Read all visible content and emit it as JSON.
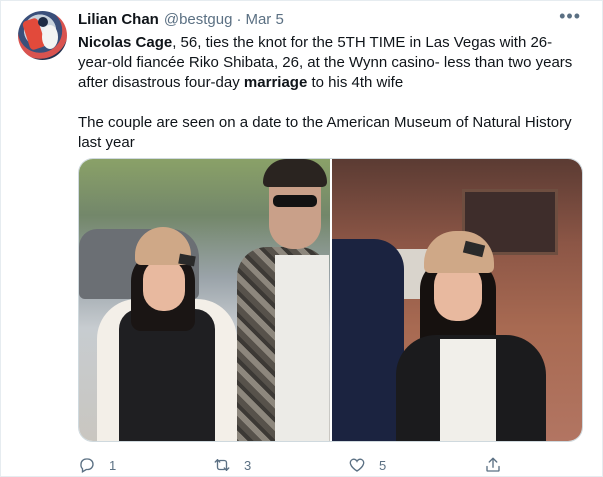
{
  "tweet": {
    "author_name": "Lilian Chan",
    "handle": "@bestgug",
    "separator": "·",
    "date": "Mar 5",
    "more_label": "•••",
    "text": {
      "bold_name": "Nicolas Cage",
      "part1": ", 56, ties the knot for the 5TH TIME in Las Vegas with 26-year-old fiancée Riko Shibata, 26, at the Wynn casino- less than two years after disastrous four-day ",
      "bold_word": "marriage",
      "part2": " to his 4th wife",
      "paragraph2": "The couple are seen on a date to the American Museum of Natural History last year"
    },
    "actions": {
      "reply_count": "1",
      "retweet_count": "3",
      "like_count": "5"
    }
  },
  "icons": {
    "avatar": "avatar",
    "more": "more-dots-icon",
    "reply": "reply-icon",
    "retweet": "retweet-icon",
    "like": "heart-icon",
    "share": "share-icon"
  },
  "colors": {
    "text": "#0f1419",
    "secondary": "#5b7083",
    "border": "#e6ecf0"
  }
}
